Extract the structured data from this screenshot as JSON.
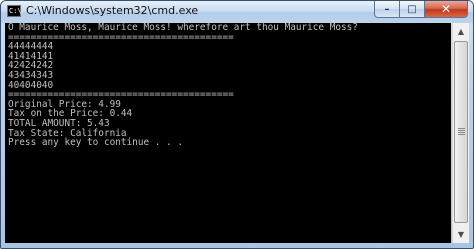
{
  "window": {
    "title": "C:\\Windows\\system32\\cmd.exe",
    "icon_label": "C:\\",
    "buttons": {
      "minimize": "–",
      "maximize": "□",
      "close": "✕"
    }
  },
  "console": {
    "lines": [
      "O Maurice Moss, Maurice Moss! wherefore art thou Maurice Moss?",
      "========================================",
      "44444444",
      "41414141",
      "42424242",
      "43434343",
      "40404040",
      "========================================",
      "Original Price: 4.99",
      "Tax on the Price: 0.44",
      "TOTAL AMOUNT: 5.43",
      "Tax State: California",
      "Press any key to continue . . ."
    ]
  },
  "scrollbar": {
    "up_arrow": "▲",
    "down_arrow": "▼"
  },
  "colors": {
    "console_background": "#000000",
    "console_text": "#c0c0c0",
    "close_button": "#c3361a"
  }
}
